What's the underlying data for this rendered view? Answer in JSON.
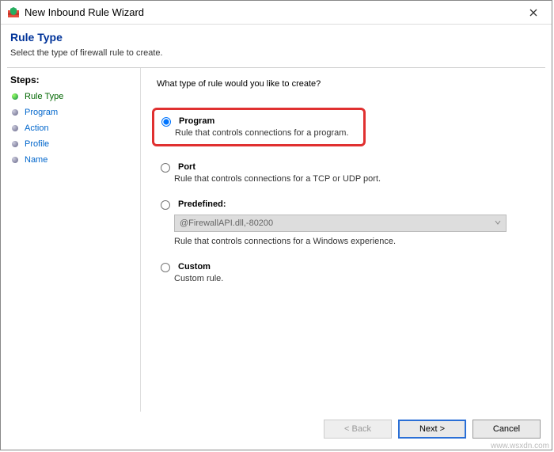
{
  "window": {
    "title": "New Inbound Rule Wizard"
  },
  "header": {
    "title": "Rule Type",
    "subtitle": "Select the type of firewall rule to create."
  },
  "sidebar": {
    "steps_label": "Steps:",
    "items": [
      {
        "label": "Rule Type"
      },
      {
        "label": "Program"
      },
      {
        "label": "Action"
      },
      {
        "label": "Profile"
      },
      {
        "label": "Name"
      }
    ]
  },
  "main": {
    "question": "What type of rule would you like to create?",
    "options": {
      "program": {
        "label": "Program",
        "desc": "Rule that controls connections for a program."
      },
      "port": {
        "label": "Port",
        "desc": "Rule that controls connections for a TCP or UDP port."
      },
      "predefined": {
        "label": "Predefined:",
        "select_value": "@FirewallAPI.dll,-80200",
        "desc": "Rule that controls connections for a Windows experience."
      },
      "custom": {
        "label": "Custom",
        "desc": "Custom rule."
      }
    }
  },
  "footer": {
    "back": "< Back",
    "next": "Next >",
    "cancel": "Cancel"
  },
  "watermark": "www.wsxdn.com"
}
